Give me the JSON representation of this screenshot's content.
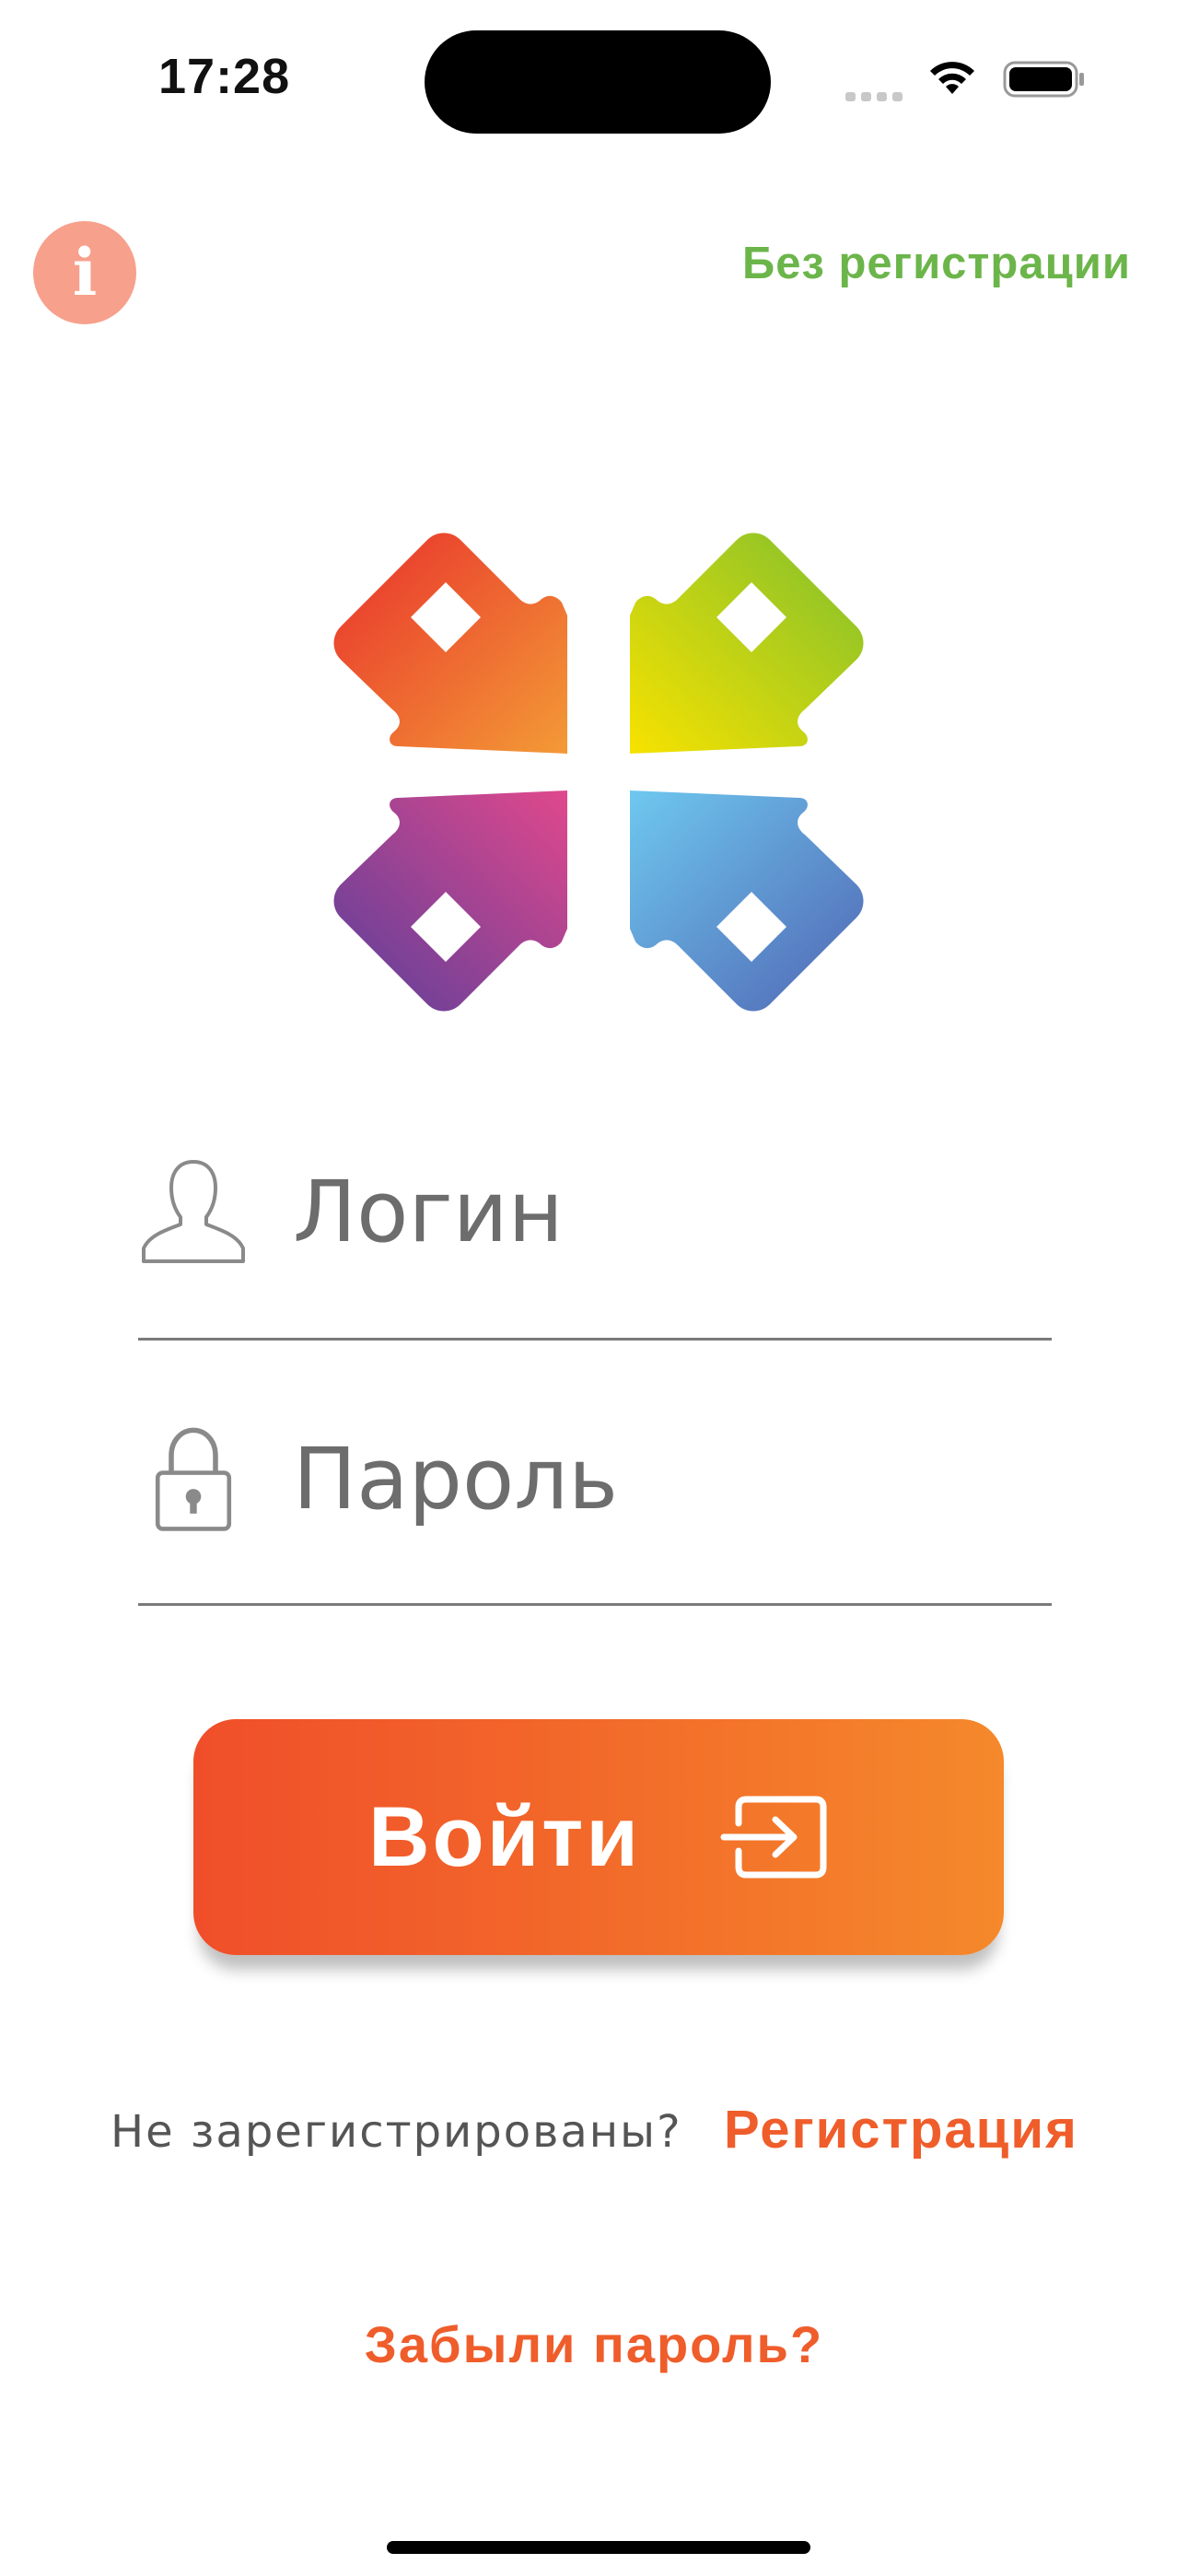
{
  "status_bar": {
    "time": "17:28"
  },
  "header": {
    "info_icon_glyph": "i",
    "no_register_label": "Без регистрации"
  },
  "form": {
    "login_placeholder": "Логин",
    "login_value": "",
    "password_placeholder": "Пароль",
    "password_value": "",
    "login_button_label": "Войти"
  },
  "footer": {
    "not_registered_text": "Не зарегистрированы?",
    "register_label": "Регистрация",
    "forgot_password_label": "Забыли пароль?"
  },
  "icons": {
    "info": "info-icon",
    "user": "user-icon",
    "lock": "lock-icon",
    "login": "sign-in-icon",
    "wifi": "wifi-icon",
    "battery": "battery-icon",
    "signal": "cellular-signal-icon"
  },
  "colors": {
    "accent_orange": "#ef5d2b",
    "accent_green": "#6bb54a",
    "info_button": "#f7a08c",
    "button_gradient_start": "#f04e2a",
    "button_gradient_end": "#f5892b"
  }
}
